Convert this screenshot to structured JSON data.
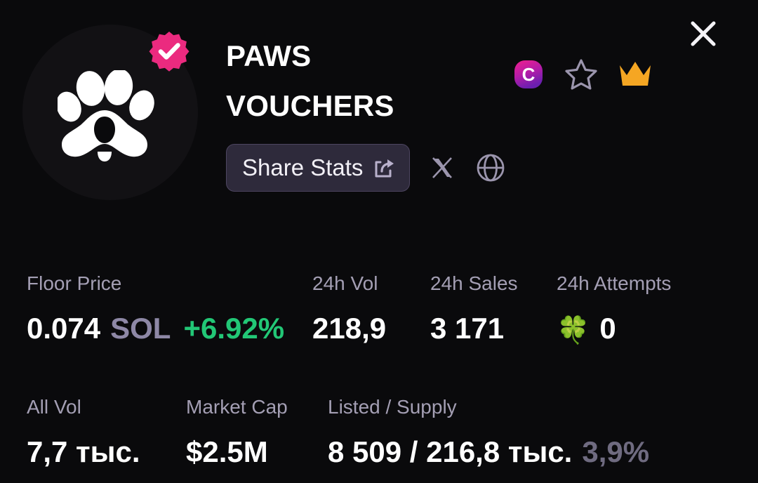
{
  "window": {
    "background": "#0a0a0c",
    "close_label": "×"
  },
  "collection": {
    "name_line1": "PAWS",
    "name_line2": "VOUCHERS",
    "verified": true,
    "avatar_icon": "paw-print-logo",
    "verified_icon": "verified-check-badge"
  },
  "badges": [
    {
      "name": "magiceden-c-badge",
      "label": "C",
      "color": "#e0179b"
    },
    {
      "name": "favorite-star",
      "label": "",
      "color": "#9b95ad"
    },
    {
      "name": "crown-badge",
      "label": "",
      "color": "#f5a623"
    }
  ],
  "actions": {
    "share_label": "Share Stats",
    "share_icon": "share-arrow-icon",
    "twitter_icon": "x-twitter-icon",
    "website_icon": "globe-icon"
  },
  "stats_row1": [
    {
      "label": "Floor Price",
      "value": "0.074",
      "unit": "SOL",
      "change": "+6.92%",
      "change_color": "#22c776"
    },
    {
      "label": "24h Vol",
      "value": "218,9",
      "unit": "",
      "change": ""
    },
    {
      "label": "24h Sales",
      "value": "3 171",
      "unit": "",
      "change": ""
    },
    {
      "label": "24h Attempts",
      "value": "0",
      "unit": "",
      "change": "",
      "icon": "four-leaf-clover",
      "glyph": "🍀"
    }
  ],
  "stats_row2": [
    {
      "label": "All Vol",
      "value": "7,7 тыс.",
      "suffix": ""
    },
    {
      "label": "Market Cap",
      "value": "$2.5M",
      "suffix": ""
    },
    {
      "label": "Listed / Supply",
      "value": "8 509 / 216,8 тыс.",
      "suffix": "3,9%"
    }
  ],
  "colors": {
    "accent_pink": "#e0179b",
    "verified_pink": "#eb2a7f",
    "gold": "#f5a623",
    "green": "#22c776",
    "muted": "#a49fb4",
    "button_bg": "#2e2a3b",
    "button_border": "#4d4560"
  }
}
